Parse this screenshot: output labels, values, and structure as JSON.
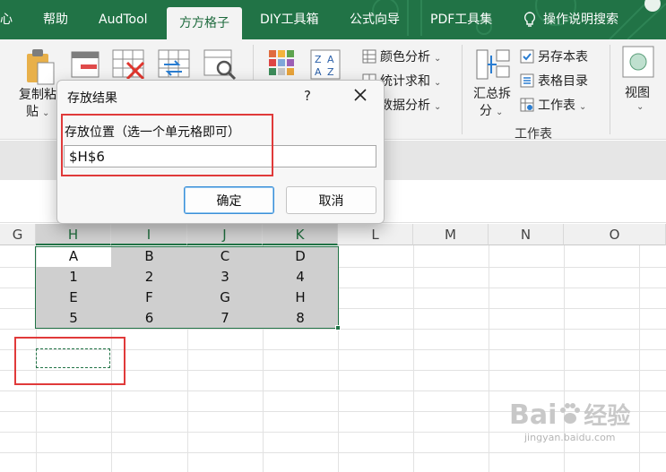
{
  "tabs": {
    "partial_left": "心",
    "items": [
      "帮助",
      "AudTool",
      "方方格子",
      "DIY工具箱",
      "公式向导",
      "PDF工具集"
    ],
    "active_index": 2,
    "help_search": "操作说明搜索"
  },
  "ribbon": {
    "paste_line1": "复制粘",
    "paste_line2": "贴",
    "color_analysis": "颜色分析",
    "stat_sum": "统计求和",
    "data_analysis": "数据分析",
    "summary_split_line1": "汇总拆",
    "summary_split_line2": "分",
    "save_sheet": "另存本表",
    "sheet_toc": "表格目录",
    "worksheet": "工作表",
    "worksheet_group": "工作表",
    "view": "视图"
  },
  "columns": [
    "G",
    "H",
    "I",
    "J",
    "K",
    "L",
    "M",
    "N",
    "O"
  ],
  "selected_columns": [
    "H",
    "I",
    "J",
    "K"
  ],
  "cells": [
    [
      "A",
      "B",
      "C",
      "D"
    ],
    [
      "1",
      "2",
      "3",
      "4"
    ],
    [
      "E",
      "F",
      "G",
      "H"
    ],
    [
      "5",
      "6",
      "7",
      "8"
    ]
  ],
  "dialog": {
    "title": "存放结果",
    "help": "?",
    "label": "存放位置（选一个单元格即可）",
    "value": "$H$6",
    "ok": "确定",
    "cancel": "取消"
  },
  "watermark": {
    "brand": "Bai",
    "brand2": "经验",
    "url": "jingyan.baidu.com"
  },
  "colors": {
    "accent": "#217346",
    "highlight_red": "#e03a3a",
    "selection_fill": "#cfcfcf"
  }
}
